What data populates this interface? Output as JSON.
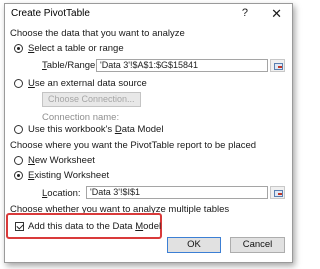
{
  "window": {
    "title": "Create PivotTable",
    "help": "?",
    "close": "✕"
  },
  "analyze": {
    "heading": "Choose the data that you want to analyze",
    "select_table": {
      "underline": "S",
      "rest": "elect a table or range"
    },
    "table_range": {
      "underline": "T",
      "rest": "able/Range:",
      "value": "'Data 3'!$A$1:$G$15841"
    },
    "external": {
      "underline": "U",
      "rest": "se an external data source"
    },
    "choose_connection": "Choose Connection...",
    "connection_name": "Connection name:",
    "data_model": {
      "before": "Use this workbook's ",
      "underline": "D",
      "rest": "ata Model"
    }
  },
  "placement": {
    "heading": "Choose where you want the PivotTable report to be placed",
    "new_ws": {
      "underline": "N",
      "rest": "ew Worksheet"
    },
    "existing_ws": {
      "underline": "E",
      "rest": "xisting Worksheet"
    },
    "location": {
      "underline": "L",
      "rest": "ocation:",
      "value": "'Data 3'!$I$1"
    }
  },
  "multiple": {
    "heading": "Choose whether you want to analyze multiple tables",
    "add_model": {
      "before": "Add this data to the Data ",
      "underline": "M",
      "rest": "odel"
    }
  },
  "buttons": {
    "ok": "OK",
    "cancel": "Cancel"
  },
  "icons": {
    "range": "range-selector-icon",
    "help": "help-icon",
    "close": "close-icon"
  }
}
